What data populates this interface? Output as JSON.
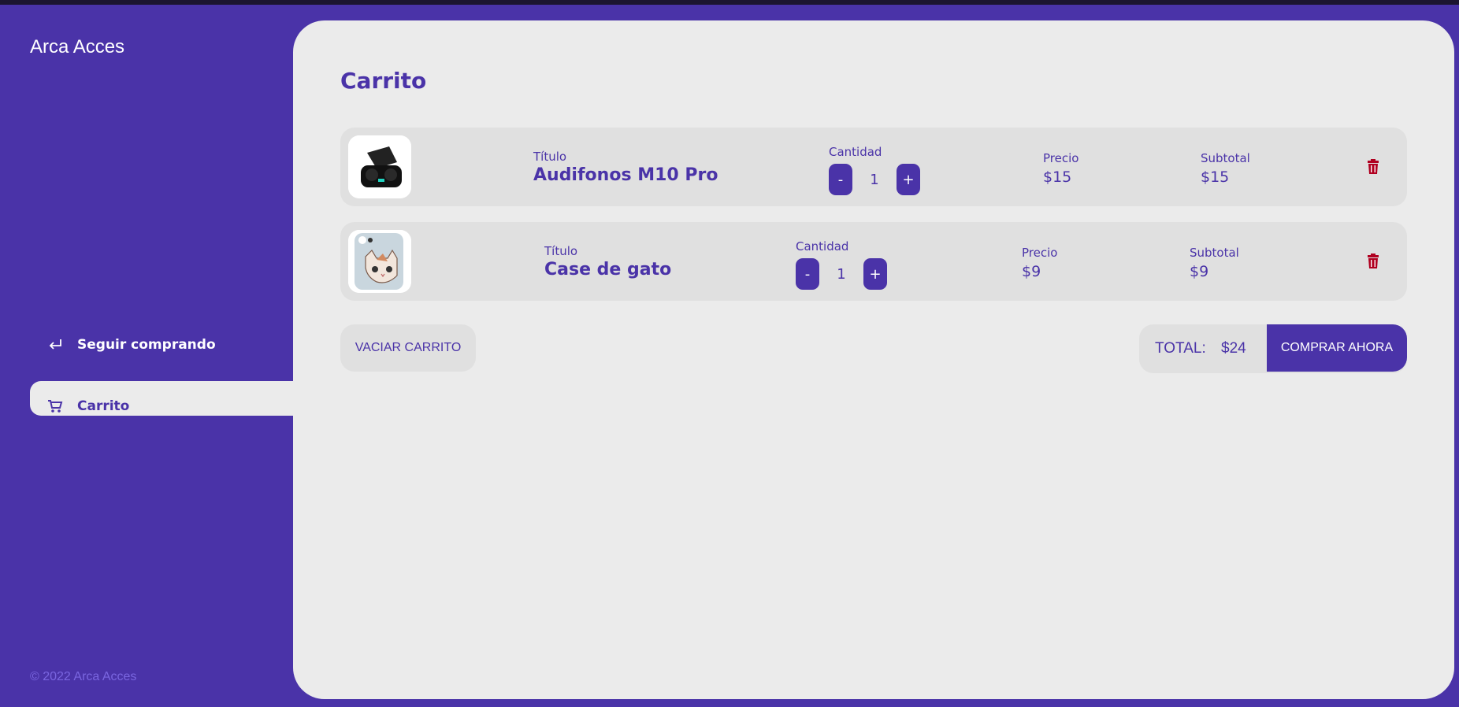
{
  "app": {
    "brand": "Arca Acces",
    "copyright": "© 2022 Arca Acces"
  },
  "nav": {
    "items": [
      {
        "label": "Seguir comprando",
        "icon": "return-arrow-icon"
      },
      {
        "label": "Carrito",
        "icon": "cart-icon"
      }
    ]
  },
  "page": {
    "title": "Carrito"
  },
  "cart": {
    "labels": {
      "title": "Título",
      "quantity": "Cantidad",
      "price": "Precio",
      "subtotal": "Subtotal",
      "minus": "-",
      "plus": "+"
    },
    "items": [
      {
        "title": "Audifonos M10 Pro",
        "quantity": "1",
        "price": "$15",
        "subtotal": "$15",
        "image": "earbuds-image"
      },
      {
        "title": "Case de gato",
        "quantity": "1",
        "price": "$9",
        "subtotal": "$9",
        "image": "cat-phone-case-image"
      }
    ],
    "clear_label": "VACIAR CARRITO",
    "total_label": "TOTAL:",
    "total_value": "$24",
    "buy_label": "COMPRAR AHORA"
  },
  "colors": {
    "primary": "#4a33a8",
    "background": "#ebebeb",
    "card": "#e0e0e0",
    "danger": "#b00020"
  }
}
